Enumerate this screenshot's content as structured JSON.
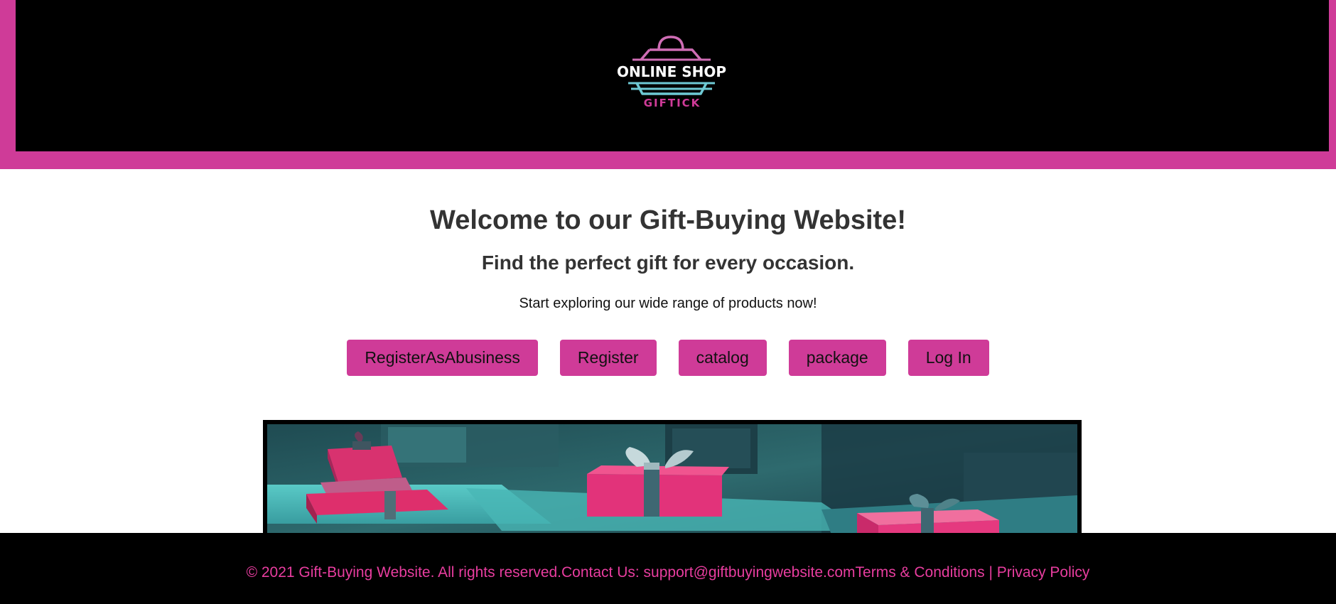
{
  "header": {
    "logo": {
      "line1": "ONLINE SHOP",
      "line2": "GIFTICK"
    }
  },
  "main": {
    "headline": "Welcome to our Gift-Buying Website!",
    "subheadline": "Find the perfect gift for every occasion.",
    "intro": "Start exploring our wide range of products now!",
    "buttons": [
      {
        "label": "RegisterAsAbusiness"
      },
      {
        "label": "Register"
      },
      {
        "label": "catalog"
      },
      {
        "label": "package"
      },
      {
        "label": "Log In"
      }
    ]
  },
  "footer": {
    "copyright": "© 2021 Gift-Buying Website. All rights reserved.",
    "contact": "Contact Us: support@giftbuyingwebsite.com",
    "terms": "Terms & Conditions",
    "separator": " | ",
    "privacy": "Privacy Policy"
  },
  "colors": {
    "brand_pink": "#cf3b98",
    "footer_text": "#e83d9f",
    "logo_teal": "#6ec9d4",
    "header_bg": "#000000"
  },
  "icons": {
    "logo_icon": "shopping-bag-icon"
  }
}
